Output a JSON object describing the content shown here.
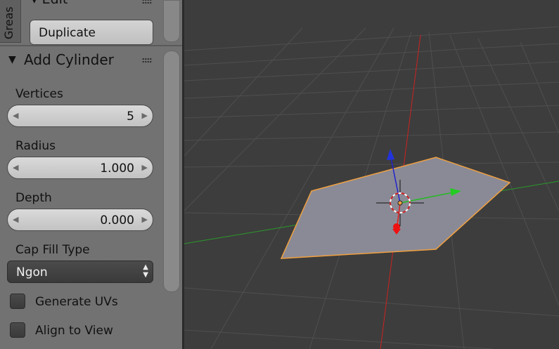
{
  "sidebar": {
    "vertical_tab": "Greas",
    "edit_header": "▾ Edit",
    "duplicate_label": "Duplicate"
  },
  "operator_panel": {
    "title": "Add Cylinder",
    "vertices": {
      "label": "Vertices",
      "value": "5"
    },
    "radius": {
      "label": "Radius",
      "value": "1.000"
    },
    "depth": {
      "label": "Depth",
      "value": "0.000"
    },
    "cap_fill": {
      "label": "Cap Fill Type",
      "value": "Ngon"
    },
    "generate_uvs": {
      "label": "Generate UVs",
      "checked": false
    },
    "align_to_view": {
      "label": "Align to View",
      "checked": false
    }
  },
  "viewport": {
    "background": "#3d3d3d",
    "grid_color": "#4f4f4f",
    "x_axis_color": "#cc2222",
    "y_axis_color": "#2a9a2a",
    "face_color": "#8a8a96",
    "selection_outline": "#f0a040"
  }
}
